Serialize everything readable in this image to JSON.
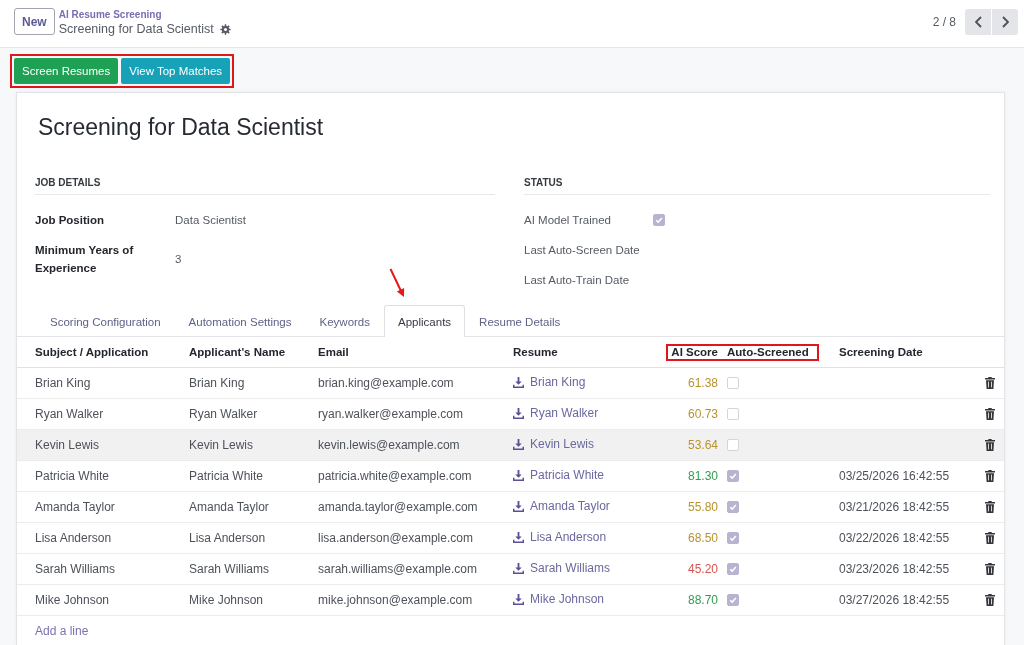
{
  "control_panel": {
    "new_button": "New",
    "breadcrumb": "AI Resume Screening",
    "record_title": "Screening for Data Scientist",
    "pager": "2 / 8"
  },
  "action_buttons": {
    "highlighted": true,
    "buttons": [
      {
        "label": "Screen Resumes",
        "kind": "success"
      },
      {
        "label": "View Top Matches",
        "kind": "info"
      }
    ]
  },
  "form": {
    "title": "Screening for Data Scientist",
    "groups": [
      {
        "heading": "JOB DETAILS",
        "fields": [
          {
            "label": "Job Position",
            "kind": "text",
            "readonly": false,
            "value": "Data Scientist"
          },
          {
            "label": "Minimum Years of Experience",
            "kind": "text",
            "readonly": false,
            "value": "3"
          }
        ]
      },
      {
        "heading": "STATUS",
        "fields": [
          {
            "label": "AI Model Trained",
            "kind": "checkbox",
            "readonly": true,
            "checked": true
          },
          {
            "label": "Last Auto-Screen Date",
            "kind": "text",
            "readonly": true
          },
          {
            "label": "Last Auto-Train Date",
            "kind": "text",
            "readonly": true
          }
        ]
      }
    ]
  },
  "tabs": [
    {
      "label": "Scoring Configuration",
      "selected": false,
      "arrow_marked": false
    },
    {
      "label": "Automation Settings",
      "selected": false,
      "arrow_marked": false
    },
    {
      "label": "Keywords",
      "selected": false,
      "arrow_marked": false
    },
    {
      "label": "Applicants",
      "selected": true,
      "arrow_marked": true
    },
    {
      "label": "Resume Details",
      "selected": false,
      "arrow_marked": false
    }
  ],
  "table": {
    "columns": [
      {
        "label": "Subject / Application",
        "kind": "text",
        "highlighted": false
      },
      {
        "label": "Applicant's Name",
        "kind": "text",
        "highlighted": false
      },
      {
        "label": "Email",
        "kind": "text",
        "highlighted": false
      },
      {
        "label": "Resume",
        "kind": "link",
        "highlighted": false
      },
      {
        "label": "AI Score",
        "kind": "number",
        "highlighted": true
      },
      {
        "label": "Auto-Screened",
        "kind": "checkbox",
        "highlighted": true
      },
      {
        "label": "Screening Date",
        "kind": "text",
        "highlighted": false
      }
    ],
    "rows": [
      {
        "subject": "Brian King",
        "applicant_name": "Brian King",
        "email": "brian.king@example.com",
        "resume": "Brian King",
        "ai_score": "61.38",
        "color": "#b8932b",
        "auto_screened": false,
        "hovered": false
      },
      {
        "subject": "Ryan Walker",
        "applicant_name": "Ryan Walker",
        "email": "ryan.walker@example.com",
        "resume": "Ryan Walker",
        "ai_score": "60.73",
        "color": "#b8932b",
        "auto_screened": false,
        "hovered": false
      },
      {
        "subject": "Kevin Lewis",
        "applicant_name": "Kevin Lewis",
        "email": "kevin.lewis@example.com",
        "resume": "Kevin Lewis",
        "ai_score": "53.64",
        "color": "#b8932b",
        "auto_screened": false,
        "hovered": true
      },
      {
        "subject": "Patricia White",
        "applicant_name": "Patricia White",
        "email": "patricia.white@example.com",
        "resume": "Patricia White",
        "ai_score": "81.30",
        "color": "#2f9e4f",
        "auto_screened": true,
        "screening_date": "03/25/2026 16:42:55",
        "hovered": false
      },
      {
        "subject": "Amanda Taylor",
        "applicant_name": "Amanda Taylor",
        "email": "amanda.taylor@example.com",
        "resume": "Amanda Taylor",
        "ai_score": "55.80",
        "color": "#b8932b",
        "auto_screened": true,
        "screening_date": "03/21/2026 18:42:55",
        "hovered": false
      },
      {
        "subject": "Lisa Anderson",
        "applicant_name": "Lisa Anderson",
        "email": "lisa.anderson@example.com",
        "resume": "Lisa Anderson",
        "ai_score": "68.50",
        "color": "#b8932b",
        "auto_screened": true,
        "screening_date": "03/22/2026 18:42:55",
        "hovered": false
      },
      {
        "subject": "Sarah Williams",
        "applicant_name": "Sarah Williams",
        "email": "sarah.williams@example.com",
        "resume": "Sarah Williams",
        "ai_score": "45.20",
        "color": "#d9534f",
        "auto_screened": true,
        "screening_date": "03/23/2026 18:42:55",
        "hovered": false
      },
      {
        "subject": "Mike Johnson",
        "applicant_name": "Mike Johnson",
        "email": "mike.johnson@example.com",
        "resume": "Mike Johnson",
        "ai_score": "88.70",
        "color": "#2f9e4f",
        "auto_screened": true,
        "screening_date": "03/27/2026 18:42:55",
        "hovered": false
      }
    ],
    "add_line": "Add a line"
  }
}
